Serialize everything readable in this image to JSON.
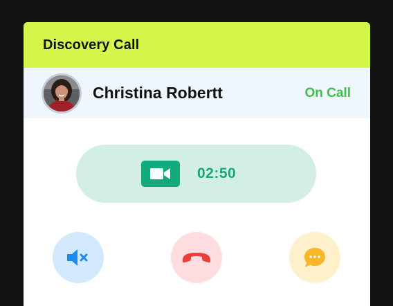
{
  "header": {
    "title": "Discovery Call"
  },
  "caller": {
    "name": "Christina Robertt",
    "status": "On Call",
    "avatar_icon": "person-avatar"
  },
  "call": {
    "timer": "02:50",
    "video_icon": "video-camera-icon"
  },
  "actions": [
    {
      "name": "mute",
      "icon": "speaker-mute-icon",
      "color": "#1a8cf0",
      "bg": "#d2e8fd"
    },
    {
      "name": "hang-up",
      "icon": "phone-hangup-icon",
      "color": "#ee3d3d",
      "bg": "#fddde0"
    },
    {
      "name": "chat",
      "icon": "chat-bubble-icon",
      "color": "#f7b62b",
      "bg": "#fff0cc"
    }
  ],
  "colors": {
    "header_bg": "#d4f54a",
    "status_green": "#3cc24c",
    "timer_green": "#16a77a",
    "pill_bg": "#d3efe5"
  }
}
